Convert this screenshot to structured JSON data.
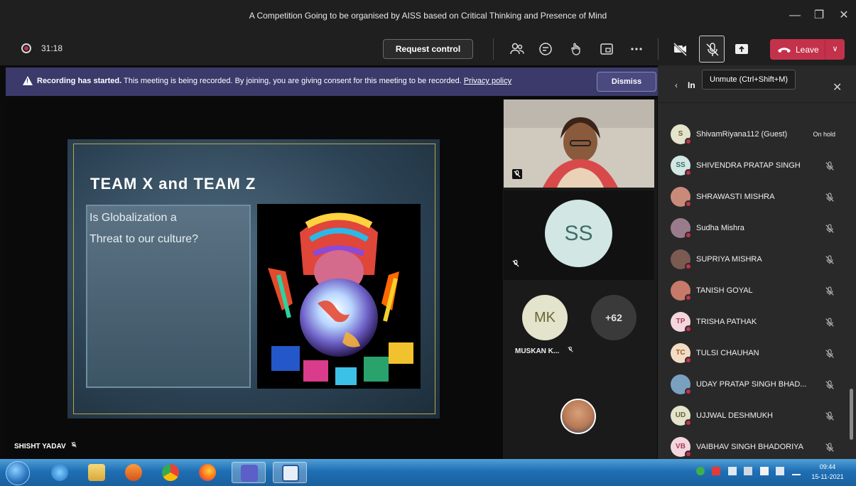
{
  "window": {
    "title": "A Competition Going to be organised by AISS based on Critical Thinking and Presence of Mind",
    "minimize_icon": "minimize-icon",
    "maximize_icon": "maximize-icon",
    "close_icon": "close-icon"
  },
  "toolbar": {
    "timer": "31:18",
    "request_control_label": "Request control",
    "leave_label": "Leave",
    "icons": [
      "participants-icon",
      "chat-icon",
      "reactions-icon",
      "rooms-icon",
      "more-icon",
      "camera-off-icon",
      "mic-off-icon",
      "share-icon",
      "phone-icon"
    ],
    "leave_color": "#c4314b"
  },
  "banner": {
    "bold": "Recording has started.",
    "text": " This meeting is being recorded. By joining, you are giving consent for this meeting to be recorded. ",
    "link": "Privacy policy",
    "dismiss_label": "Dismiss",
    "background": "#3b3a6b"
  },
  "tooltip": {
    "text": "Unmute (Ctrl+Shift+M)"
  },
  "panel": {
    "header_partial": "In",
    "participants": [
      {
        "initials": "S",
        "name": "ShivamRiyana112 (Guest)",
        "status": "On hold",
        "av_bg": "#e4e3cb",
        "av_fg": "#6a6636"
      },
      {
        "initials": "SS",
        "name": "SHIVENDRA PRATAP SINGH",
        "status": "",
        "av_bg": "#d2e7e4",
        "av_fg": "#3e6f6a"
      },
      {
        "initials": "",
        "name": "SHRAWASTI MISHRA",
        "status": "",
        "av_bg": "#c98a7a",
        "av_fg": "#fff"
      },
      {
        "initials": "",
        "name": "Sudha Mishra",
        "status": "",
        "av_bg": "#9a7b8c",
        "av_fg": "#fff"
      },
      {
        "initials": "",
        "name": "SUPRIYA MISHRA",
        "status": "",
        "av_bg": "#7b5a52",
        "av_fg": "#fff"
      },
      {
        "initials": "",
        "name": "TANISH GOYAL",
        "status": "",
        "av_bg": "#c77a6a",
        "av_fg": "#fff"
      },
      {
        "initials": "TP",
        "name": "TRISHA PATHAK",
        "status": "",
        "av_bg": "#f3d6de",
        "av_fg": "#a8415a"
      },
      {
        "initials": "TC",
        "name": "TULSI CHAUHAN",
        "status": "",
        "av_bg": "#f3dcc6",
        "av_fg": "#a0602a"
      },
      {
        "initials": "",
        "name": "UDAY PRATAP SINGH BHAD...",
        "status": "",
        "av_bg": "#7aa0c0",
        "av_fg": "#fff"
      },
      {
        "initials": "UD",
        "name": "UJJWAL DESHMUKH",
        "status": "",
        "av_bg": "#e4e3cb",
        "av_fg": "#6a6636"
      },
      {
        "initials": "VB",
        "name": "VAIBHAV SINGH BHADORIYA",
        "status": "",
        "av_bg": "#f3d6de",
        "av_fg": "#a8415a"
      }
    ]
  },
  "stage": {
    "slide_title": "TEAM X and TEAM Z",
    "slide_line1": "Is Globalization a",
    "slide_line2": "Threat to our culture?",
    "speaker_name": "SHISHT YADAV"
  },
  "gallery": {
    "avatar_ss": "SS",
    "avatar_mk": "MK",
    "mk_name": "MUSKAN K...",
    "more_count": "+62"
  },
  "taskbar": {
    "apps": [
      "ie-icon",
      "explorer-icon",
      "media-player-icon",
      "chrome-icon",
      "firefox-icon",
      "teams-icon",
      "word-icon"
    ],
    "time": "09:44",
    "date": "15-11-2021"
  }
}
